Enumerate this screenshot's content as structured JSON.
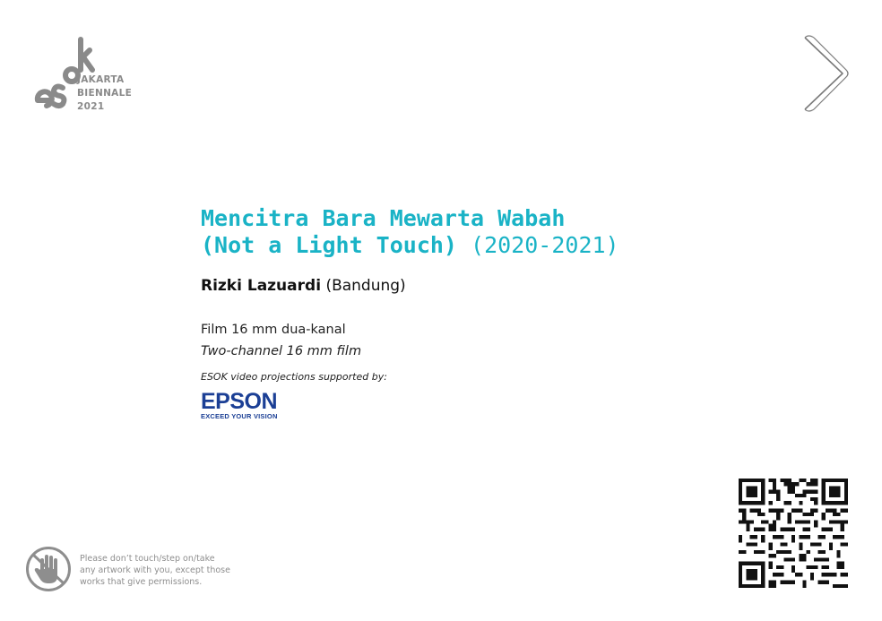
{
  "logo": {
    "mark": "esok",
    "line1": "JAKARTA",
    "line2": "BIENNALE",
    "line3": "2021"
  },
  "nav": {
    "next_icon": "chevron-right-icon"
  },
  "artwork": {
    "title_line1": "Mencitra Bara Mewarta Wabah",
    "title_line2": "(Not a Light Touch)",
    "year": "(2020-2021)",
    "artist_name": "Rizki Lazuardi",
    "artist_city": "(Bandung)",
    "medium_id": "Film 16 mm dua-kanal",
    "medium_en": "Two-channel 16 mm film"
  },
  "sponsor": {
    "support_text": "ESOK video projections supported by:",
    "brand": "EPSON",
    "tagline": "EXCEED YOUR VISION"
  },
  "qr_icon": "qr-code-icon",
  "notice": {
    "icon": "no-touch-hand-icon",
    "line1": "Please don’t touch/step on/take",
    "line2": "any artwork with you, except those",
    "line3": "works that give permissions."
  },
  "colors": {
    "title": "#1ab3c6",
    "brand_blue": "#1b3f95",
    "logo_gray": "#8a8a8a",
    "notice_gray": "#8e8e8e"
  }
}
